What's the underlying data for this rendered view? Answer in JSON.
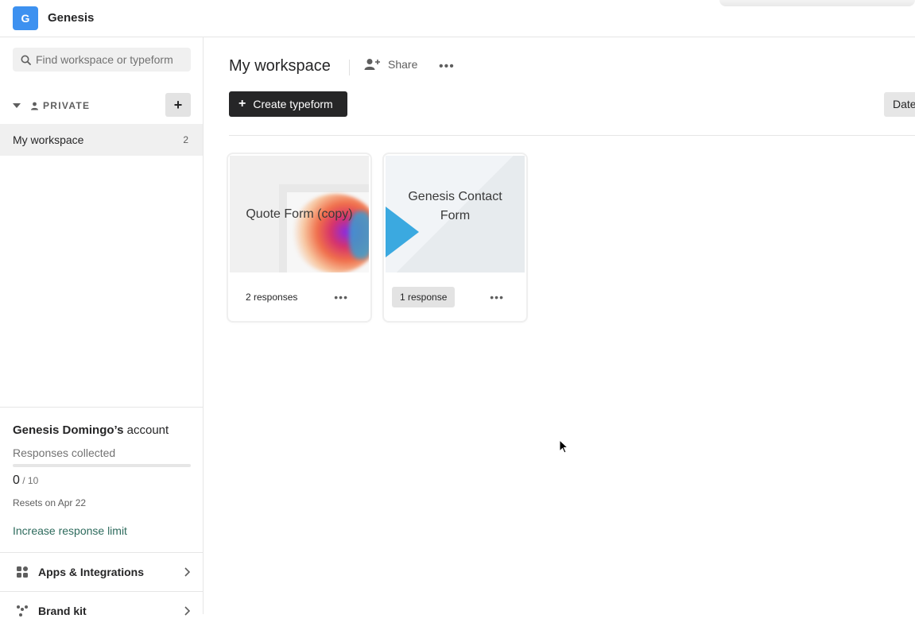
{
  "org": {
    "initial": "G",
    "name": "Genesis"
  },
  "sidebar": {
    "search_placeholder": "Find workspace or typeform",
    "section_label": "PRIVATE",
    "add_label": "+",
    "workspace": {
      "name": "My workspace",
      "count": "2"
    },
    "account": {
      "name": "Genesis Domingo’s",
      "suffix": " account",
      "responses_label": "Responses collected",
      "used": "0",
      "limit": " / 10",
      "usage_fraction": 0,
      "resets": "Resets on Apr 22",
      "increase_link": "Increase response limit"
    },
    "nav": [
      {
        "label": "Apps & Integrations",
        "icon": "apps-icon"
      },
      {
        "label": "Brand kit",
        "icon": "brand-kit-icon"
      }
    ]
  },
  "main": {
    "title": "My workspace",
    "share_label": "Share",
    "more_label": "•••",
    "create_label": "Create typeform",
    "create_plus": "+",
    "sort_label": "Date",
    "cards": [
      {
        "title": "Quote Form (copy)",
        "responses": "2 responses",
        "more": "•••"
      },
      {
        "title": "Genesis Contact Form",
        "responses": "1 response",
        "more": "•••"
      }
    ]
  },
  "colors": {
    "brand_avatar": "#3d91f0",
    "primary_button": "#262627",
    "link": "#2e6b5d",
    "accent_triangle": "#3ba9e0"
  }
}
